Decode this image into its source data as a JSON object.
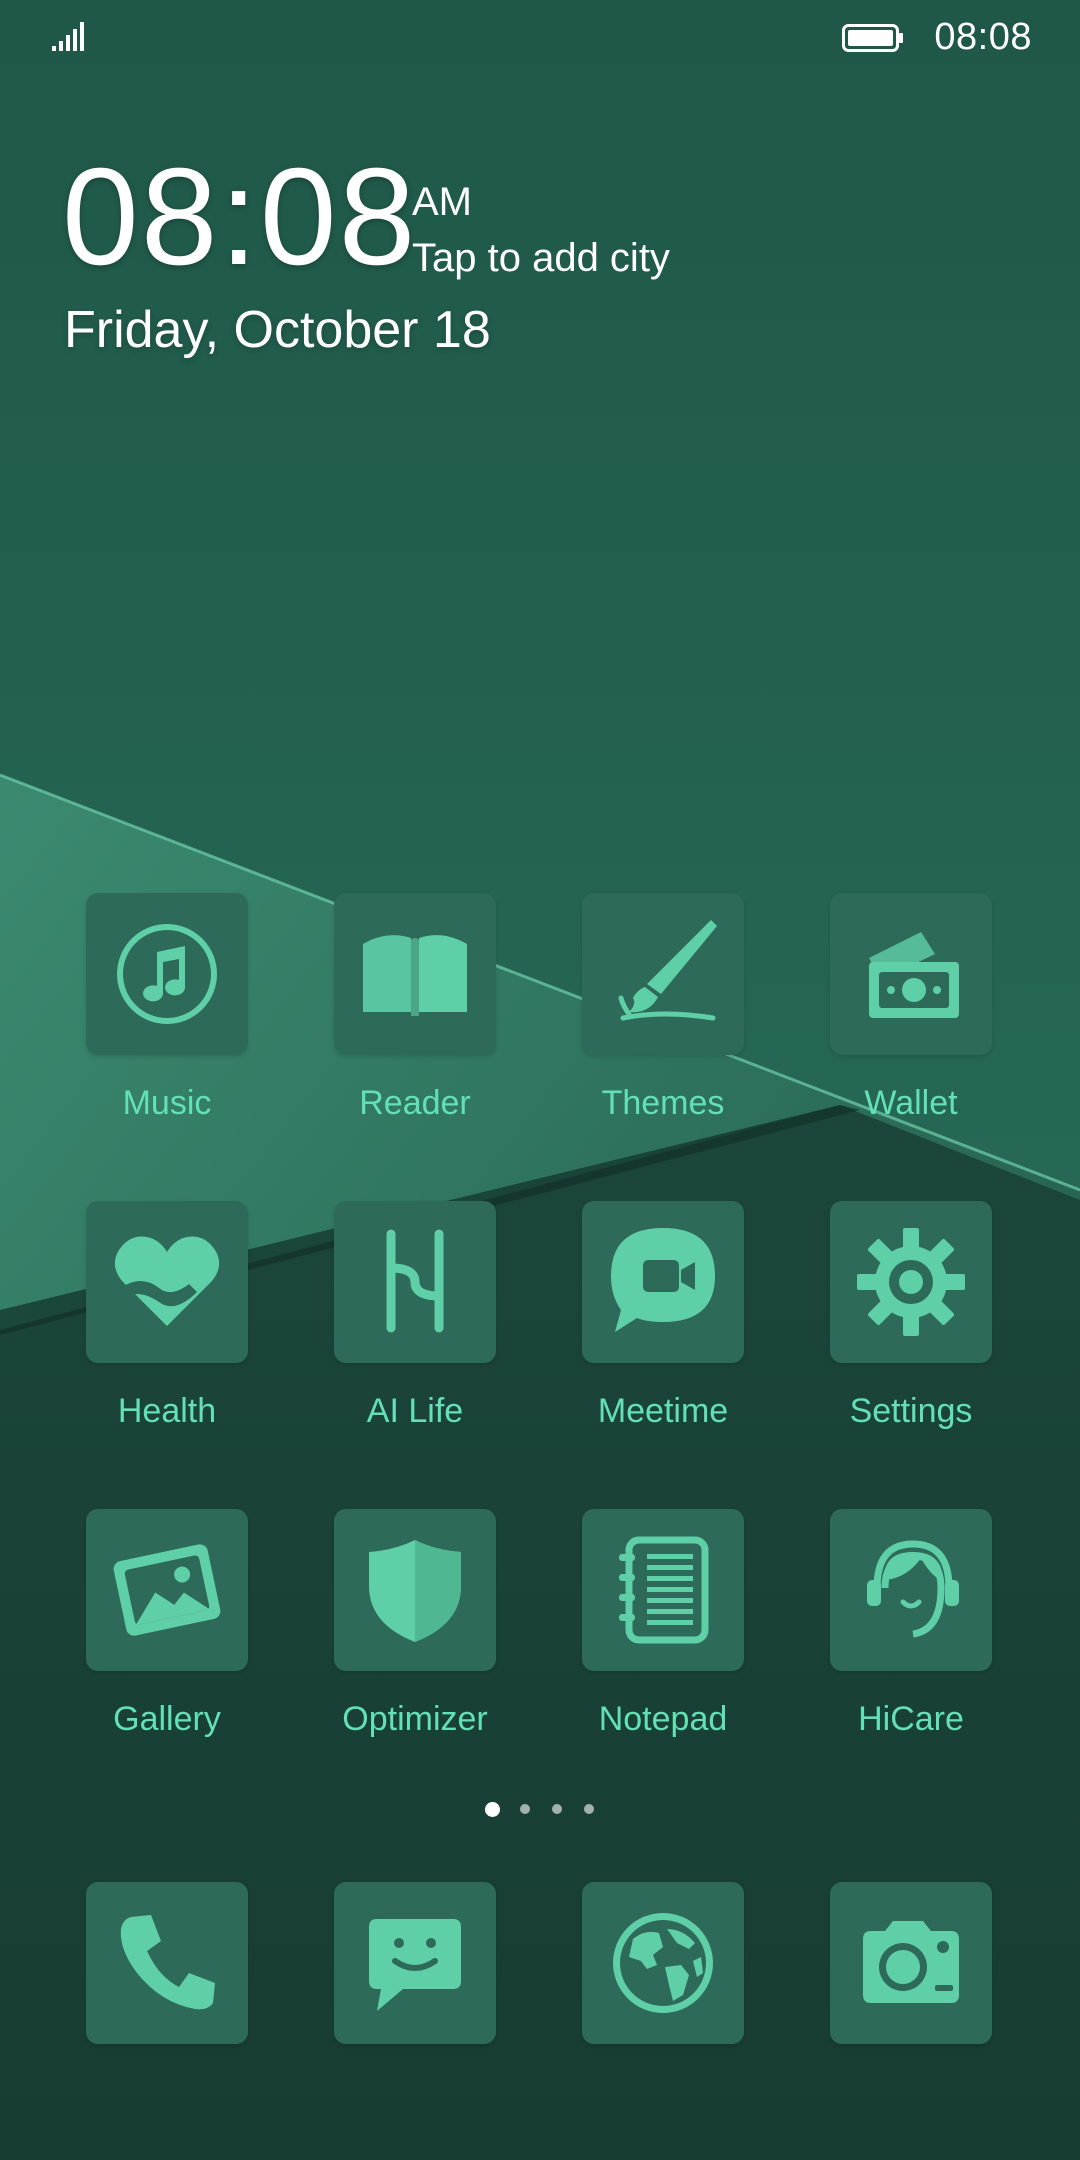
{
  "status_bar": {
    "time": "08:08",
    "signal_icon": "signal-icon",
    "battery_icon": "battery-icon"
  },
  "clock_widget": {
    "time": "08:08",
    "ampm": "AM",
    "city_prompt": "Tap to add city",
    "date": "Friday, October 18"
  },
  "apps": [
    {
      "label": "Music",
      "icon": "music-icon"
    },
    {
      "label": "Reader",
      "icon": "book-icon"
    },
    {
      "label": "Themes",
      "icon": "paintbrush-icon"
    },
    {
      "label": "Wallet",
      "icon": "wallet-icon"
    },
    {
      "label": "Health",
      "icon": "heart-icon"
    },
    {
      "label": "AI Life",
      "icon": "ai-life-icon"
    },
    {
      "label": "Meetime",
      "icon": "video-chat-icon"
    },
    {
      "label": "Settings",
      "icon": "gear-icon"
    },
    {
      "label": "Gallery",
      "icon": "photo-icon"
    },
    {
      "label": "Optimizer",
      "icon": "shield-icon"
    },
    {
      "label": "Notepad",
      "icon": "notepad-icon"
    },
    {
      "label": "HiCare",
      "icon": "headset-icon"
    }
  ],
  "dock": [
    {
      "icon": "phone-icon"
    },
    {
      "icon": "message-icon"
    },
    {
      "icon": "globe-icon"
    },
    {
      "icon": "camera-icon"
    }
  ],
  "page_indicator": {
    "pages": 4,
    "current": 1
  },
  "colors": {
    "label": "#63e0b6",
    "icon": "#5fcfa8",
    "tile": "#2e6a59",
    "wallpaper": "#1f5547"
  }
}
